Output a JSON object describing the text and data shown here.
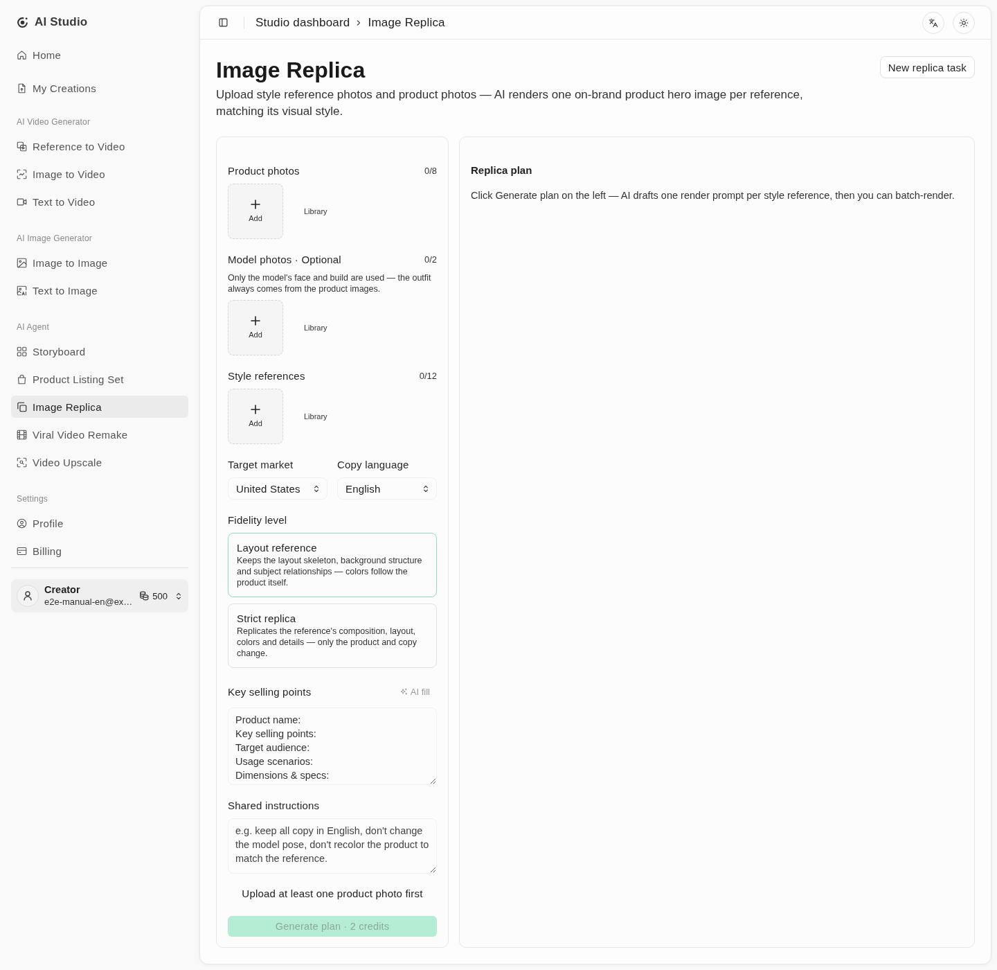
{
  "sidebar": {
    "brand": "AI Studio",
    "sections": [
      {
        "items": [
          {
            "label": "Home",
            "selected": false
          },
          {
            "label": "My Creations",
            "selected": false
          }
        ]
      },
      {
        "heading": "AI Video Generator",
        "items": [
          {
            "label": "Reference to Video",
            "selected": false
          },
          {
            "label": "Image to Video",
            "selected": false
          },
          {
            "label": "Text to Video",
            "selected": false
          }
        ]
      },
      {
        "heading": "AI Image Generator",
        "items": [
          {
            "label": "Image to Image",
            "selected": false
          },
          {
            "label": "Text to Image",
            "selected": false
          }
        ]
      },
      {
        "heading": "AI Agent",
        "items": [
          {
            "label": "Storyboard",
            "selected": false
          },
          {
            "label": "Product Listing Set",
            "selected": false
          },
          {
            "label": "Image Replica",
            "selected": true
          },
          {
            "label": "Viral Video Remake",
            "selected": false
          },
          {
            "label": "Video Upscale",
            "selected": false
          }
        ]
      },
      {
        "heading": "Settings",
        "items": [
          {
            "label": "Profile",
            "selected": false
          },
          {
            "label": "Billing",
            "selected": false
          }
        ]
      }
    ],
    "account": {
      "name": "Creator",
      "email": "e2e-manual-en@ex…",
      "credits": "500"
    }
  },
  "header": {
    "breadcrumb": [
      "Studio dashboard",
      "Image Replica"
    ]
  },
  "page": {
    "title": "Image Replica",
    "description": "Upload style reference photos and product photos — AI renders one on-brand product hero image per reference, matching its visual style.",
    "new_task_button": "New replica task"
  },
  "form": {
    "uploads": [
      {
        "label": "Product photos",
        "count": "0/8",
        "add": "Add",
        "library": "Library"
      },
      {
        "label": "Model photos · Optional",
        "count": "0/2",
        "help": "Only the model's face and build are used — the outfit always comes from the product images.",
        "add": "Add",
        "library": "Library"
      },
      {
        "label": "Style references",
        "count": "0/12",
        "add": "Add",
        "library": "Library"
      }
    ],
    "selects": [
      {
        "label": "Target market",
        "value": "United States"
      },
      {
        "label": "Copy language",
        "value": "English"
      }
    ],
    "fidelity": {
      "label": "Fidelity level",
      "options": [
        {
          "title": "Layout reference",
          "description": "Keeps the layout skeleton, background structure and subject relationships — colors follow the product itself.",
          "selected": true
        },
        {
          "title": "Strict replica",
          "description": "Replicates the reference's composition, layout, colors and details — only the product and copy change.",
          "selected": false
        }
      ]
    },
    "selling_points": {
      "label": "Key selling points",
      "ai_fill": "AI fill",
      "value": "Product name:\nKey selling points:\nTarget audience:\nUsage scenarios:\nDimensions & specs:"
    },
    "instructions": {
      "label": "Shared instructions",
      "placeholder": "e.g. keep all copy in English, don't change the model pose, don't recolor the product to match the reference."
    },
    "notice": "Upload at least one product photo first",
    "generate": {
      "label": "Generate plan · 2 credits",
      "disabled": true
    }
  },
  "plan": {
    "title": "Replica plan",
    "text": "Click Generate plan on the left — AI drafts one render prompt per style reference, then you can batch-render."
  }
}
